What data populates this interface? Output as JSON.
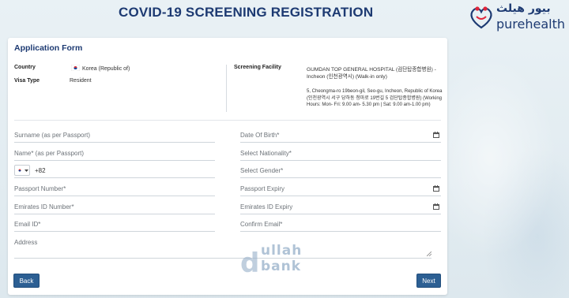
{
  "header": {
    "title": "COVID-19 SCREENING REGISTRATION",
    "logo_arabic": "بيور هيلث",
    "logo_word": "purehealth"
  },
  "form": {
    "title": "Application Form",
    "country_label": "Country",
    "country_value": "Korea (Republic of)",
    "visa_label": "Visa Type",
    "visa_value": "Resident",
    "facility_label": "Screening Facility",
    "facility_name": "GUMDAN TOP GENERAL HOSPITAL (검단탑종합병원) -Incheon (인천광역시) (Walk-in only)",
    "facility_address": "5, Cheongma-ro 19beon-gil, Seo-gu, Incheon, Republic of Korea (인천광역시 서구 당하동 청마로 19번길 5 검단탑종합병원) (Working Hours: Mon- Fri: 9.00 am- 5.30 pm | Sat: 9.00 am-1.00 pm)"
  },
  "fields": {
    "surname": "Surname (as per Passport)",
    "dob": "Date Of Birth*",
    "name": "Name* (as per Passport)",
    "nationality": "Select Nationality*",
    "phone_code": "+82",
    "gender": "Select Gender*",
    "passport_number": "Passport Number*",
    "passport_expiry": "Passport Expiry",
    "emirates_id": "Emirates ID Number*",
    "emirates_expiry": "Emirates ID Expiry",
    "email": "Email ID*",
    "confirm_email": "Confirm Email*",
    "address": "Address"
  },
  "buttons": {
    "back": "Back",
    "next": "Next"
  },
  "watermark": {
    "top": "ullah",
    "bottom": "bank",
    "letter": "d"
  },
  "colors": {
    "brand": "#1d3a72",
    "button": "#2c5f93"
  }
}
